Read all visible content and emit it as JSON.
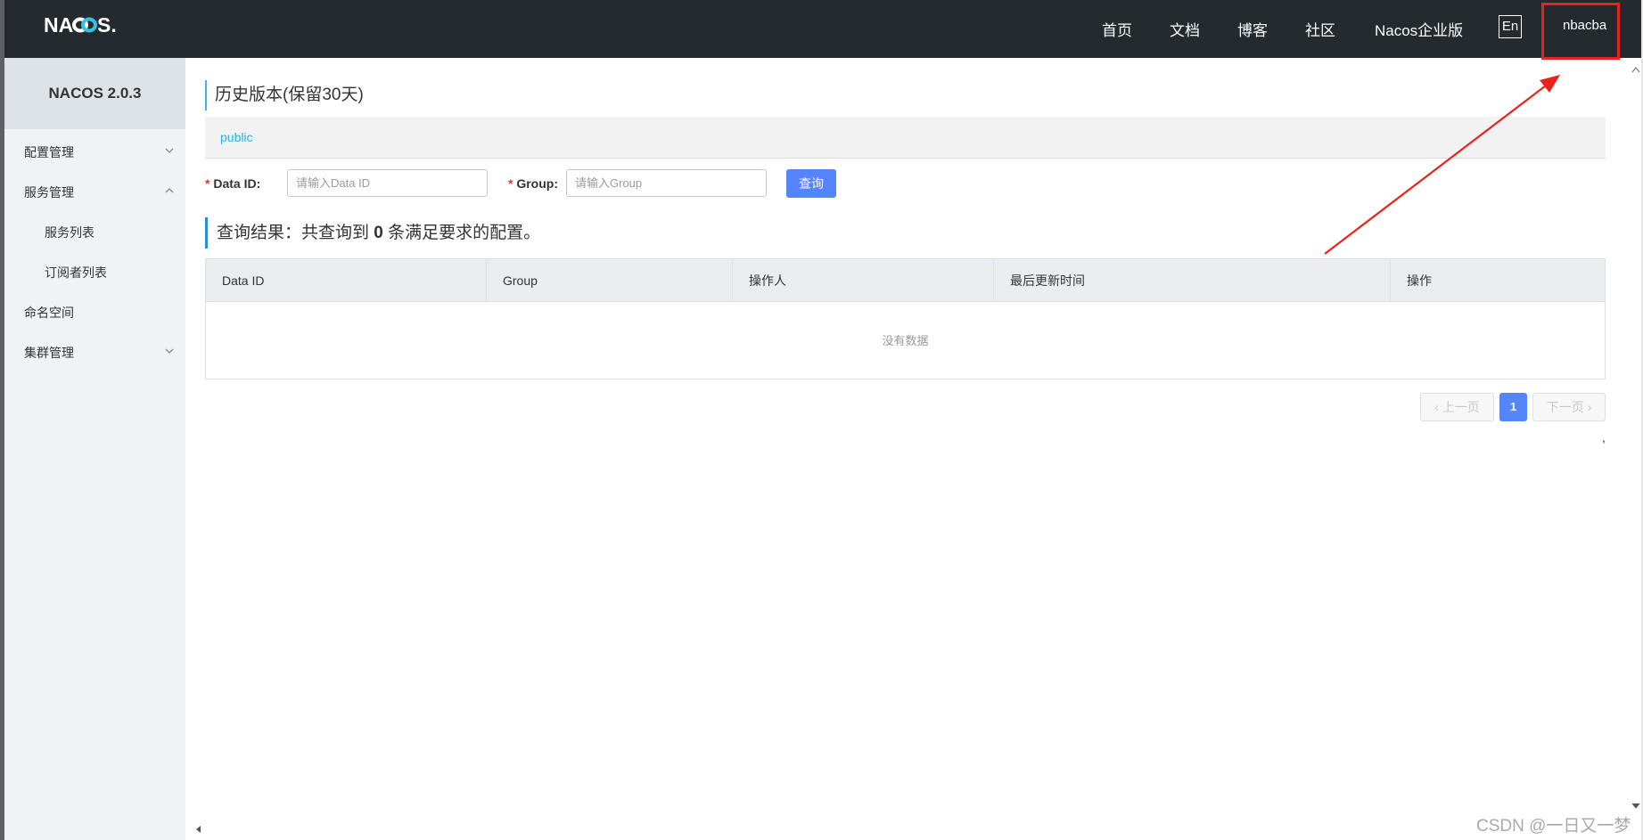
{
  "header": {
    "logo_text": "NACOS.",
    "nav": [
      "首页",
      "文档",
      "博客",
      "社区",
      "Nacos企业版"
    ],
    "lang": "En",
    "user": "nbacba"
  },
  "sidebar": {
    "version": "NACOS 2.0.3",
    "items": [
      {
        "label": "配置管理",
        "expanded": false
      },
      {
        "label": "服务管理",
        "expanded": true
      },
      {
        "label": "服务列表"
      },
      {
        "label": "订阅者列表"
      },
      {
        "label": "命名空间"
      },
      {
        "label": "集群管理",
        "expanded": false
      }
    ]
  },
  "main": {
    "title": "历史版本(保留30天)",
    "namespace": "public",
    "form": {
      "data_id_label": "Data ID:",
      "data_id_placeholder": "请输入Data ID",
      "group_label": "Group:",
      "group_placeholder": "请输入Group",
      "required_mark": "*",
      "query_button": "查询"
    },
    "result": {
      "prefix": "查询结果：共查询到",
      "count": "0",
      "suffix": "条满足要求的配置。"
    },
    "table": {
      "columns": [
        "Data ID",
        "Group",
        "操作人",
        "最后更新时间",
        "操作"
      ],
      "rows": [],
      "empty_text": "没有数据"
    },
    "pagination": {
      "prev": "上一页",
      "current": "1",
      "next": "下一页"
    },
    "stray_mark": ","
  },
  "colors": {
    "accent_blue": "#5584ff",
    "annotation_red": "#e8231b",
    "header_bg": "#252a2f"
  },
  "watermark": "CSDN @一日又一梦"
}
